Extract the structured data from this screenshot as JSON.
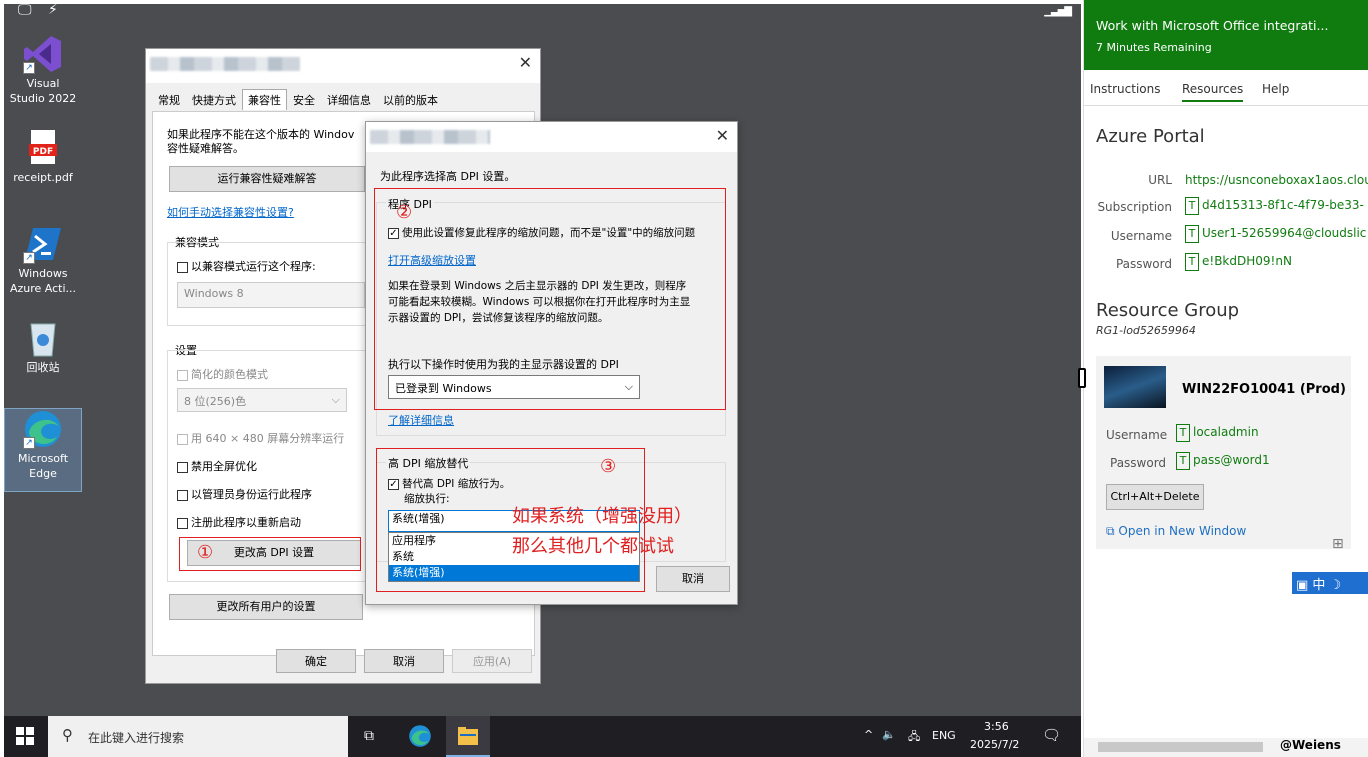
{
  "desktop": {
    "icons": [
      {
        "label1": "Visual",
        "label2": "Studio 2022"
      },
      {
        "label1": "receipt.pdf",
        "label2": ""
      },
      {
        "label1": "Windows",
        "label2": "Azure Acti..."
      },
      {
        "label1": "回收站",
        "label2": ""
      },
      {
        "label1": "Microsoft",
        "label2": "Edge"
      }
    ],
    "pdf_badge": "PDF"
  },
  "props_dialog": {
    "tabs": [
      "常规",
      "快捷方式",
      "兼容性",
      "安全",
      "详细信息",
      "以前的版本"
    ],
    "intro": "如果此程序不能在这个版本的 Windov",
    "intro2": "容性疑难解答。",
    "run_troubleshooter": "运行兼容性疑难解答",
    "manual_link": "如何手动选择兼容性设置?",
    "compat_mode_title": "兼容模式",
    "compat_mode_check": "以兼容模式运行这个程序:",
    "compat_os": "Windows 8",
    "settings_title": "设置",
    "reduced_color": "简化的颜色模式",
    "color_value": "8 位(256)色",
    "run_640": "用 640 × 480 屏幕分辨率运行",
    "disable_fullscreen": "禁用全屏优化",
    "run_admin": "以管理员身份运行此程序",
    "register_restart": "注册此程序以重新启动",
    "change_dpi": "更改高 DPI 设置",
    "change_all_users": "更改所有用户的设置",
    "ok": "确定",
    "cancel": "取消",
    "apply": "应用(A)"
  },
  "dpi_dialog": {
    "header": "为此程序选择高 DPI 设置。",
    "program_dpi_title": "程序 DPI",
    "program_dpi_check": "使用此设置修复此程序的缩放问题，而不是\"设置\"中的缩放问题",
    "open_advanced": "打开高级缩放设置",
    "desc1": "如果在登录到 Windows 之后主显示器的 DPI 发生更改，则程序",
    "desc2": "可能看起来较模糊。Windows 可以根据你在打开此程序时为主显",
    "desc3": "示器设置的 DPI，尝试修复该程序的缩放问题。",
    "use_dpi_label": "执行以下操作时使用为我的主显示器设置的 DPI",
    "use_dpi_value": "已登录到 Windows",
    "learn_more": "了解详细信息",
    "override_title": "高 DPI 缩放替代",
    "override_check": "替代高 DPI 缩放行为。",
    "scaling_performed": "缩放执行:",
    "scaling_value": "系统(增强)",
    "options": [
      "应用程序",
      "系统",
      "系统(增强)"
    ],
    "cancel": "取消"
  },
  "annotations": {
    "n1": "①",
    "n2": "②",
    "n3": "③",
    "note1": "如果系统（增强没用）",
    "note2": "那么其他几个都试试"
  },
  "taskbar": {
    "search_placeholder": "在此键入进行搜索",
    "lang": "ENG",
    "time": "3:56",
    "date": "2025/7/2"
  },
  "panel": {
    "lab_title": "Work with Microsoft Office integrati...",
    "remaining": "7 Minutes Remaining",
    "tabs": [
      "Instructions",
      "Resources",
      "Help"
    ],
    "azure_title": "Azure Portal",
    "url_label": "URL",
    "url_value": "https://usnconeboxax1aos.clou",
    "subscription_label": "Subscription",
    "subscription_value": "d4d15313-8f1c-4f79-be33-",
    "username_label": "Username",
    "username_value": "User1-52659964@cloudslic",
    "password_label": "Password",
    "password_value": "e!BkdDH09!nN",
    "rg_title": "Resource Group",
    "rg_value": "RG1-lod52659964",
    "vm_name": "WIN22FO10041 (Prod)",
    "vm_username_label": "Username",
    "vm_username_value": "localadmin",
    "vm_password_label": "Password",
    "vm_password_value": "pass@word1",
    "cad": "Ctrl+Alt+Delete",
    "open_new_window": "Open in New Window",
    "t": "T",
    "ime": "中",
    "watermark": "@Weiens"
  },
  "colors": {
    "accent_green": "#107c10",
    "annotation_red": "#e02020",
    "link_blue": "#0066cc",
    "select_blue": "#0078d7"
  }
}
